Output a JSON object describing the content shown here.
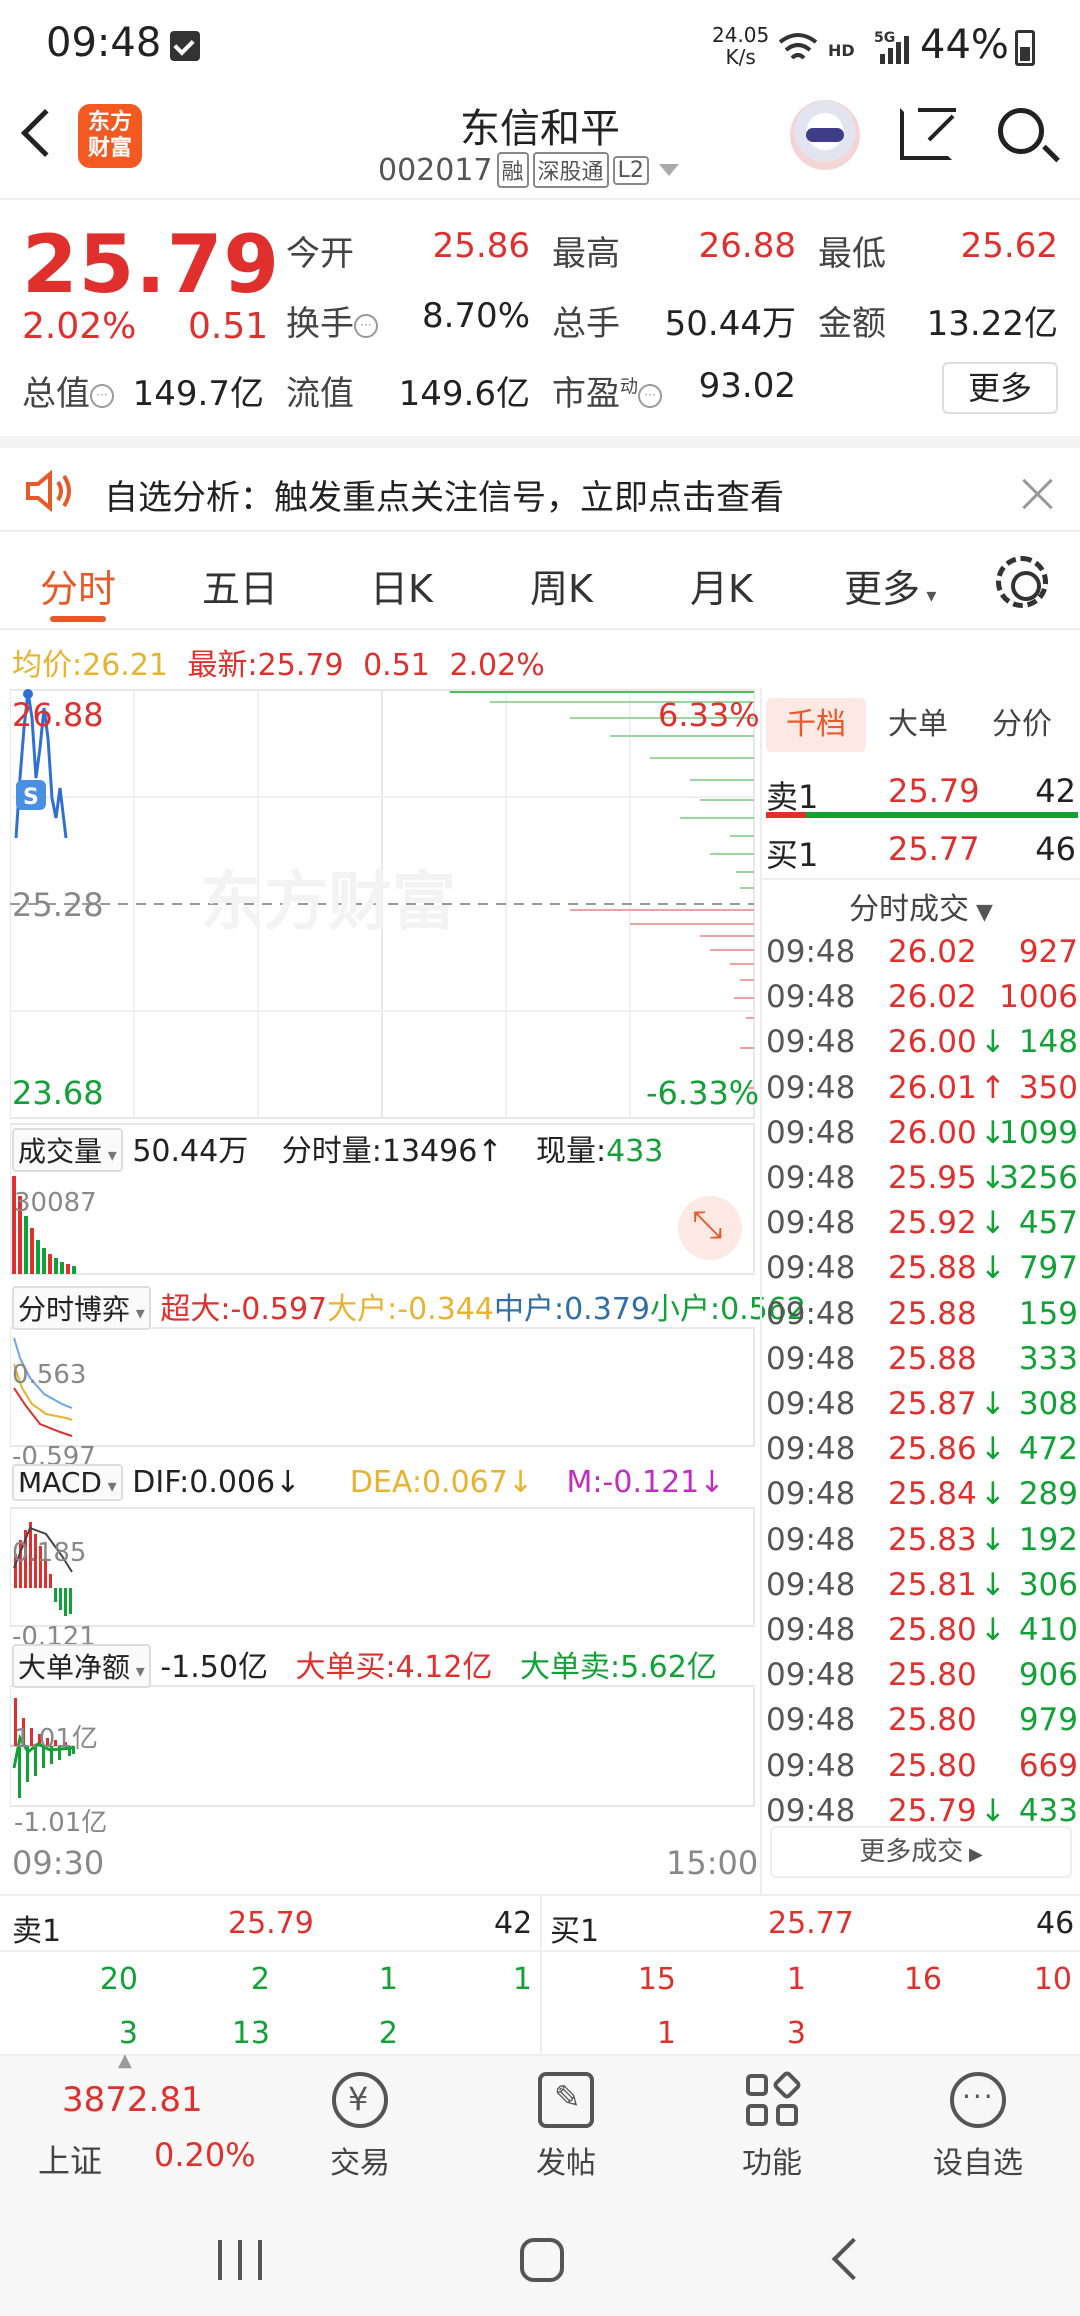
{
  "status_bar": {
    "time": "09:48",
    "speed_value": "24.05",
    "speed_unit": "K/s",
    "network": "HD",
    "signal": "5G",
    "battery": "44%"
  },
  "header": {
    "logo_text": "东方财富",
    "stock_name": "东信和平",
    "stock_code": "002017",
    "tags": [
      "融",
      "深股通",
      "L2"
    ]
  },
  "quote": {
    "price": "25.79",
    "change_pct": "2.02%",
    "change_abs": "0.51",
    "fields": [
      {
        "label": "今开",
        "value": "25.86",
        "color": "red"
      },
      {
        "label": "最高",
        "value": "26.88",
        "color": "red"
      },
      {
        "label": "最低",
        "value": "25.62",
        "color": "red"
      },
      {
        "label": "换手",
        "value": "8.70%",
        "color": "black"
      },
      {
        "label": "总手",
        "value": "50.44万",
        "color": "black"
      },
      {
        "label": "金额",
        "value": "13.22亿",
        "color": "black"
      },
      {
        "label": "总值",
        "value": "149.7亿",
        "color": "black"
      },
      {
        "label": "流值",
        "value": "149.6亿",
        "color": "black"
      },
      {
        "label": "市盈",
        "value": "93.02",
        "color": "black"
      }
    ],
    "pe_superscript": "动",
    "more_label": "更多"
  },
  "notice": {
    "text": "自选分析：触发重点关注信号，立即点击查看"
  },
  "tabs": [
    "分时",
    "五日",
    "日K",
    "周K",
    "月K",
    "更多"
  ],
  "avg_line": {
    "avg_label": "均价:",
    "avg_value": "26.21",
    "latest_label": "最新:",
    "latest_value": "25.79",
    "change_abs": "0.51",
    "change_pct": "2.02%"
  },
  "chart": {
    "price_high": "26.88",
    "price_mid": "25.28",
    "price_low": "23.68",
    "pct_high": "6.33%",
    "pct_low": "-6.33%",
    "watermark": "东方财富",
    "volume": {
      "selector": "成交量",
      "total": "50.44万",
      "time_vol_label": "分时量:",
      "time_vol": "13496↑",
      "cur_vol_label": "现量:",
      "cur_vol": "433",
      "axis_max": "30087"
    },
    "game": {
      "selector": "分时博弈",
      "super_label": "超大:",
      "super": "-0.597",
      "big_label": "大户:",
      "big": "-0.344",
      "mid_label": "中户:",
      "mid": "0.379",
      "small_label": "小户:",
      "small": "0.562",
      "axis_max": "0.563",
      "axis_min": "-0.597"
    },
    "macd": {
      "selector": "MACD",
      "dif": "DIF:0.006↓",
      "dea": "DEA:0.067↓",
      "m": "M:-0.121↓",
      "axis_max": "0.185",
      "axis_min": "-0.121"
    },
    "net": {
      "selector": "大单净额",
      "net": "-1.50亿",
      "buy_label": "大单买:",
      "buy": "4.12亿",
      "sell_label": "大单卖:",
      "sell": "5.62亿",
      "axis_max": "1.01亿",
      "axis_min": "-1.01亿"
    },
    "time_start": "09:30",
    "time_end": "15:00"
  },
  "right_panel": {
    "tabs": [
      "千档",
      "大单",
      "分价"
    ],
    "sell1": {
      "label": "卖1",
      "price": "25.79",
      "qty": "42"
    },
    "buy1": {
      "label": "买1",
      "price": "25.77",
      "qty": "46"
    },
    "ticks_title": "分时成交",
    "ticks": [
      {
        "time": "09:48",
        "price": "26.02",
        "arrow": "",
        "vol": "927",
        "vcolor": "red"
      },
      {
        "time": "09:48",
        "price": "26.02",
        "arrow": "",
        "vol": "1006",
        "vcolor": "red"
      },
      {
        "time": "09:48",
        "price": "26.00",
        "arrow": "↓",
        "vol": "148",
        "vcolor": "green"
      },
      {
        "time": "09:48",
        "price": "26.01",
        "arrow": "↑",
        "vol": "350",
        "vcolor": "red"
      },
      {
        "time": "09:48",
        "price": "26.00",
        "arrow": "↓",
        "vol": "1099",
        "vcolor": "green"
      },
      {
        "time": "09:48",
        "price": "25.95",
        "arrow": "↓",
        "vol": "3256",
        "vcolor": "green"
      },
      {
        "time": "09:48",
        "price": "25.92",
        "arrow": "↓",
        "vol": "457",
        "vcolor": "green"
      },
      {
        "time": "09:48",
        "price": "25.88",
        "arrow": "↓",
        "vol": "797",
        "vcolor": "green"
      },
      {
        "time": "09:48",
        "price": "25.88",
        "arrow": "",
        "vol": "159",
        "vcolor": "green"
      },
      {
        "time": "09:48",
        "price": "25.88",
        "arrow": "",
        "vol": "333",
        "vcolor": "green"
      },
      {
        "time": "09:48",
        "price": "25.87",
        "arrow": "↓",
        "vol": "308",
        "vcolor": "green"
      },
      {
        "time": "09:48",
        "price": "25.86",
        "arrow": "↓",
        "vol": "472",
        "vcolor": "green"
      },
      {
        "time": "09:48",
        "price": "25.84",
        "arrow": "↓",
        "vol": "289",
        "vcolor": "green"
      },
      {
        "time": "09:48",
        "price": "25.83",
        "arrow": "↓",
        "vol": "192",
        "vcolor": "green"
      },
      {
        "time": "09:48",
        "price": "25.81",
        "arrow": "↓",
        "vol": "306",
        "vcolor": "green"
      },
      {
        "time": "09:48",
        "price": "25.80",
        "arrow": "↓",
        "vol": "410",
        "vcolor": "green"
      },
      {
        "time": "09:48",
        "price": "25.80",
        "arrow": "",
        "vol": "906",
        "vcolor": "green"
      },
      {
        "time": "09:48",
        "price": "25.80",
        "arrow": "",
        "vol": "979",
        "vcolor": "green"
      },
      {
        "time": "09:48",
        "price": "25.80",
        "arrow": "",
        "vol": "669",
        "vcolor": "red"
      },
      {
        "time": "09:48",
        "price": "25.79",
        "arrow": "↓",
        "vol": "433",
        "vcolor": "green"
      }
    ],
    "more_ticks": "更多成交"
  },
  "order_book": {
    "sell_label": "卖1",
    "sell_price": "25.79",
    "sell_qty": "42",
    "buy_label": "买1",
    "buy_price": "25.77",
    "buy_qty": "46",
    "sell_row1": [
      "20",
      "2",
      "1",
      "1"
    ],
    "sell_row2": [
      "3",
      "13",
      "2"
    ],
    "buy_row1": [
      "15",
      "1",
      "16",
      "10"
    ],
    "buy_row2": [
      "1",
      "3"
    ]
  },
  "bottom_nav": {
    "index_value": "3872.81",
    "index_name": "上证",
    "index_pct": "0.20%",
    "items": [
      {
        "label": "交易",
        "icon": "yen-exchange-icon"
      },
      {
        "label": "发帖",
        "icon": "edit-icon"
      },
      {
        "label": "功能",
        "icon": "grid-icon"
      },
      {
        "label": "设自选",
        "icon": "more-dots-icon"
      }
    ]
  }
}
